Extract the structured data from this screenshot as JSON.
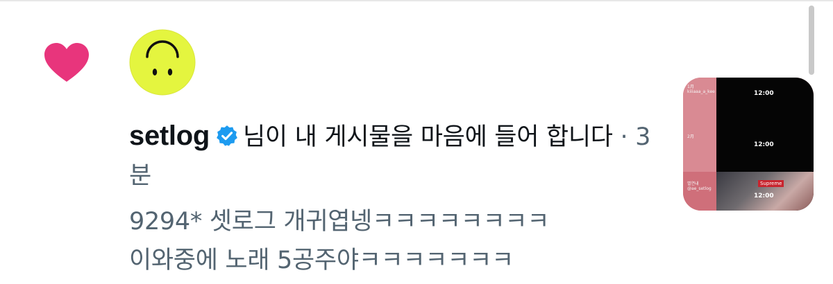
{
  "notification": {
    "type_icon": "heart-icon",
    "type_color": "#e8357c",
    "avatar_icon": "upside-down-smiley-icon",
    "avatar_color": "#e4f53f",
    "username": "setlog",
    "verified_badge_color": "#1d9bf0",
    "action_text": "님이 내 게시물을 마음에 들어 합니다",
    "separator": "·",
    "time": "3분",
    "comment_line1": "9294* 셋로그 개귀엽넹ㅋㅋㅋㅋㅋㅋㅋㅋ",
    "comment_line2": "이와중에 노래 5공주야ㅋㅋㅋㅋㅋㅋㅋ"
  },
  "thumbnail": {
    "clock_1": "12:00",
    "clock_2": "12:00",
    "clock_3": "12:00",
    "side_label_1": "1月\nkiiiaaa_a_kee",
    "side_label_2": "2月",
    "side_label_3": "3月",
    "side_label_4": "별연내\n@ae_setlog",
    "brand_text": "Supreme"
  }
}
